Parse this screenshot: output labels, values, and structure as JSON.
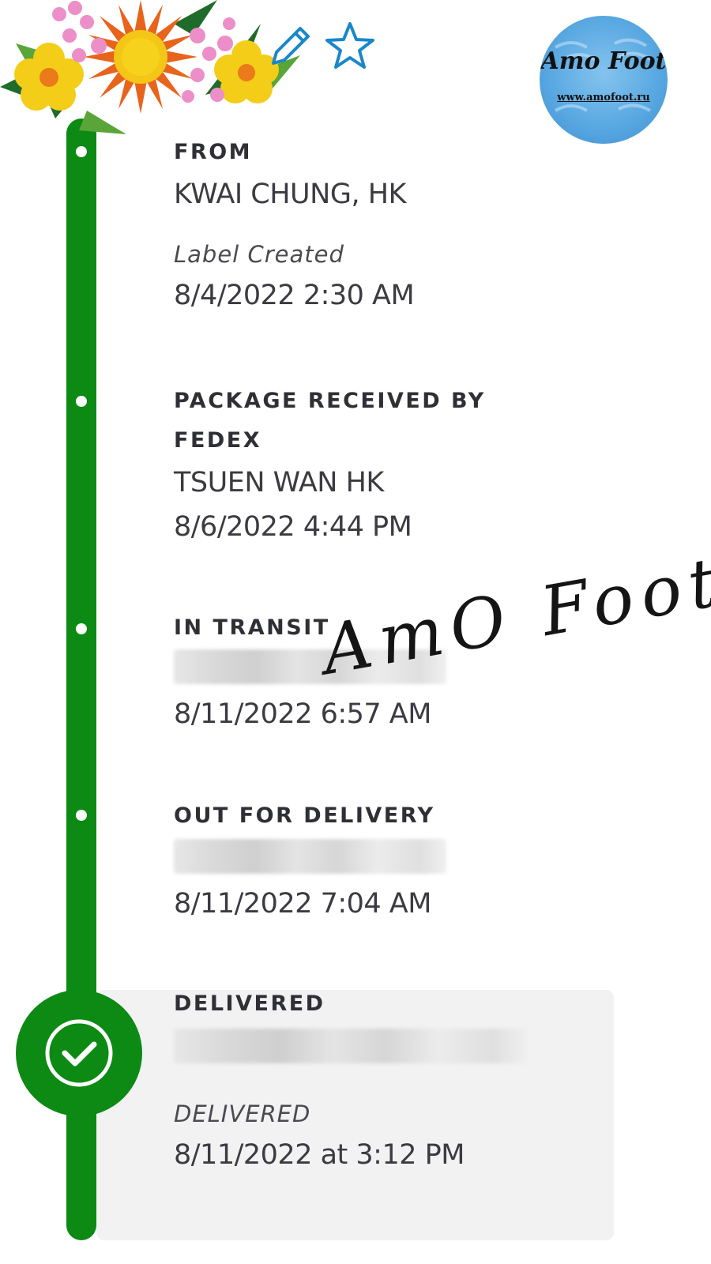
{
  "colors": {
    "rail": "#0c8a14",
    "icon_blue": "#1a87c9",
    "card_bg": "#f2f2f3",
    "text": "#2f2f36"
  },
  "toolbar": {
    "edit_icon": "pencil-icon",
    "favorite_icon": "star-icon"
  },
  "logo": {
    "name": "Amo Foot",
    "url": "www.amofoot.ru"
  },
  "watermark": "AmO Foot",
  "stages": {
    "from": {
      "title": "FROM",
      "location": "KWAI CHUNG, HK",
      "note": "Label Created",
      "datetime": "8/4/2022 2:30 AM"
    },
    "received": {
      "title_line1": "PACKAGE RECEIVED BY",
      "title_line2": "FEDEX",
      "location": "TSUEN WAN HK",
      "datetime": "8/6/2022 4:44 PM"
    },
    "transit": {
      "title": "IN TRANSIT",
      "datetime": "8/11/2022 6:57 AM"
    },
    "out": {
      "title": "OUT FOR DELIVERY",
      "datetime": "8/11/2022 7:04 AM"
    },
    "delivered": {
      "title": "DELIVERED",
      "note": "DELIVERED",
      "datetime": "8/11/2022 at 3:12 PM",
      "icon": "check-icon"
    }
  }
}
